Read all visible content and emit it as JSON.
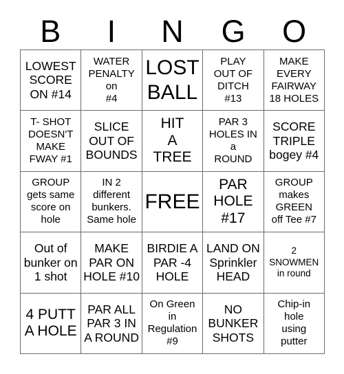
{
  "card": {
    "title_letters": [
      "B",
      "I",
      "N",
      "G",
      "O"
    ],
    "columns": 5,
    "rows": 5,
    "free_space_index": 12,
    "colors": {
      "background": "#ffffff",
      "grid_line": "#6b6b6b",
      "text": "#000000"
    },
    "cells": [
      {
        "text": "LOWEST\nSCORE\nON #14",
        "size": "md"
      },
      {
        "text": "WATER\nPENALTY\non\n#4",
        "size": "sm"
      },
      {
        "text": "LOST\nBALL",
        "size": "xl"
      },
      {
        "text": "PLAY\nOUT OF\nDITCH\n#13",
        "size": "sm"
      },
      {
        "text": "MAKE\nEVERY\nFAIRWAY\n18 HOLES",
        "size": "sm"
      },
      {
        "text": "T- SHOT\nDOESN'T\nMAKE\nFWAY #1",
        "size": "sm"
      },
      {
        "text": "SLICE\nOUT OF\nBOUNDS",
        "size": "md"
      },
      {
        "text": "HIT\nA\nTREE",
        "size": "lg"
      },
      {
        "text": "PAR 3\nHOLES IN\na\nROUND",
        "size": "sm"
      },
      {
        "text": "SCORE\nTRIPLE\nbogey #4",
        "size": "md"
      },
      {
        "text": "GROUP\ngets same\nscore on\nhole",
        "size": "sm"
      },
      {
        "text": "IN 2\ndifferent\nbunkers.\nSame hole",
        "size": "sm"
      },
      {
        "text": "FREE",
        "size": "xl"
      },
      {
        "text": "PAR\nHOLE\n#17",
        "size": "lg"
      },
      {
        "text": "GROUP\nmakes\nGREEN\noff Tee #7",
        "size": "sm"
      },
      {
        "text": "Out of\nbunker on\n1 shot",
        "size": "md"
      },
      {
        "text": "MAKE\nPAR ON\nHOLE #10",
        "size": "md"
      },
      {
        "text": "BIRDIE A\nPAR -4\nHOLE",
        "size": "md"
      },
      {
        "text": "LAND ON\nSprinkler\nHEAD",
        "size": "md"
      },
      {
        "text": "2\nSNOWMEN\nin round",
        "size": "xs"
      },
      {
        "text": "4 PUTT\nA HOLE",
        "size": "lg"
      },
      {
        "text": "PAR ALL\nPAR 3 IN\nA ROUND",
        "size": "md"
      },
      {
        "text": "On Green\nin\nRegulation\n#9",
        "size": "sm"
      },
      {
        "text": "NO\nBUNKER\nSHOTS",
        "size": "md"
      },
      {
        "text": "Chip-in\nhole\nusing\nputter",
        "size": "sm"
      }
    ]
  }
}
